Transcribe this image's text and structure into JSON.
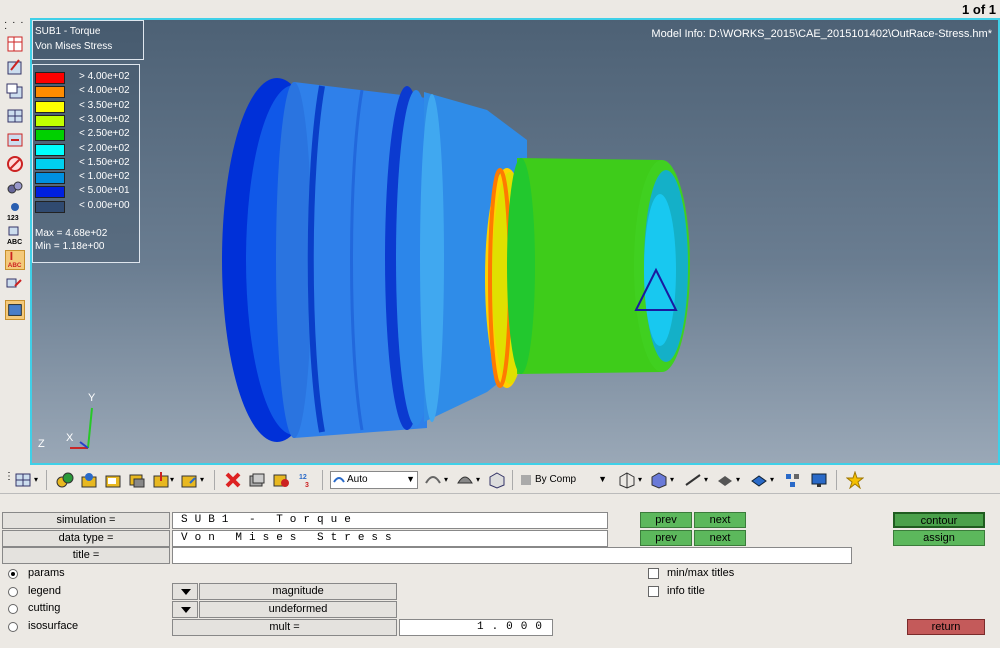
{
  "page_counter": "1 of 1",
  "viewport": {
    "model_info": "Model Info: D:\\WORKS_2015\\CAE_2015101402\\OutRace-Stress.hm*",
    "title_line1": "SUB1 - Torque",
    "title_line2": "Von Mises Stress",
    "legend": [
      {
        "label": "> 4.00e+02",
        "color": "#ff0000"
      },
      {
        "label": "< 4.00e+02",
        "color": "#ff8c00"
      },
      {
        "label": "< 3.50e+02",
        "color": "#ffff00"
      },
      {
        "label": "< 3.00e+02",
        "color": "#c0ff00"
      },
      {
        "label": "< 2.50e+02",
        "color": "#00d000"
      },
      {
        "label": "< 2.00e+02",
        "color": "#00ffff"
      },
      {
        "label": "< 1.50e+02",
        "color": "#00d0f0"
      },
      {
        "label": "< 1.00e+02",
        "color": "#0090e0"
      },
      {
        "label": "< 5.00e+01",
        "color": "#0020e0"
      },
      {
        "label": "< 0.00e+00",
        "color": "#304a70"
      }
    ],
    "max_text": "Max = 4.68e+02",
    "min_text": "Min = 1.18e+00",
    "axis": {
      "y": "Y",
      "z": "Z",
      "x": "X"
    }
  },
  "toolstrip": {
    "auto_label": "Auto",
    "bycomp_label": "By Comp",
    "icons": [
      "display-icon",
      "component-icon",
      "assembly-icon",
      "folder-icon",
      "parts-icon",
      "mask-icon",
      "unmask-icon",
      "delete-icon",
      "entity-icon",
      "hide-icon",
      "numbering-icon",
      "shade-icon",
      "style-icon",
      "cube-icon",
      "box-icon",
      "line-icon",
      "plane-icon",
      "shape-icon",
      "network-icon",
      "monitor-icon",
      "star-icon"
    ]
  },
  "panel": {
    "simulation_label": "simulation =",
    "simulation_value": "SUB1 - Torque",
    "datatype_label": "data type =",
    "datatype_value": "Von Mises Stress",
    "title_label": "title =",
    "title_value": "",
    "prev_label": "prev",
    "next_label": "next",
    "contour_label": "contour",
    "assign_label": "assign",
    "radios": [
      {
        "label": "params",
        "checked": true
      },
      {
        "label": "legend",
        "checked": false
      },
      {
        "label": "cutting",
        "checked": false
      },
      {
        "label": "isosurface",
        "checked": false
      }
    ],
    "magnitude_label": "magnitude",
    "undeformed_label": "undeformed",
    "mult_label": "mult =",
    "mult_value": "1.000",
    "minmax_titles_label": "min/max titles",
    "info_title_label": "info title",
    "return_label": "return"
  }
}
